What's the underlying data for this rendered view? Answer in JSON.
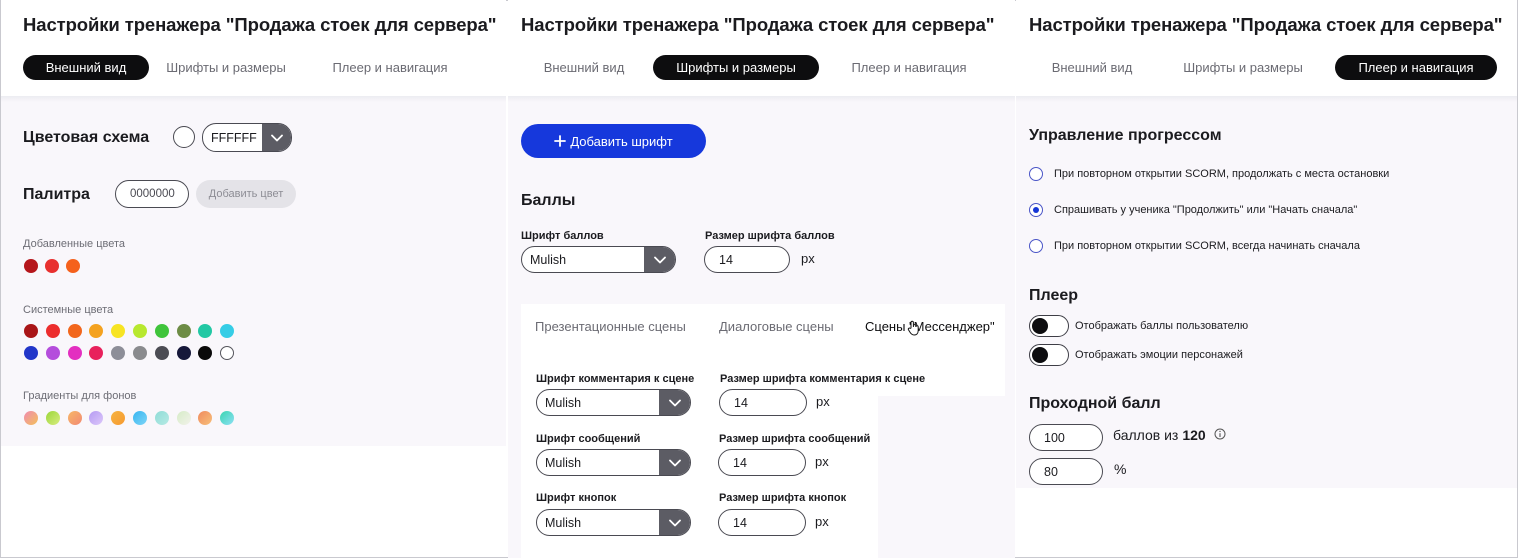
{
  "app_title": "Настройки тренажера \"Продажа стоек для сервера\"",
  "tabs": [
    "Внешний вид",
    "Шрифты и размеры",
    "Плеер и навигация"
  ],
  "appearance": {
    "color_scheme_label": "Цветовая схема",
    "color_scheme_value": "FFFFFF",
    "palette_label": "Палитра",
    "palette_input_placeholder": "0000000",
    "add_color_button": "Добавить цвет",
    "added_colors_label": "Добавленные цвета",
    "added_colors": [
      "#b5161b",
      "#e8302f",
      "#f5611c"
    ],
    "system_colors_label": "Системные цвета",
    "system_colors_row1": [
      "#a91517",
      "#ec2d2d",
      "#f2661c",
      "#f4a21f",
      "#f7e423",
      "#b7e82f",
      "#3fc43b",
      "#6d8c45",
      "#22c8a4",
      "#36cde6"
    ],
    "system_colors_row2": [
      "#2236c9",
      "#b44ddc",
      "#e32fc0",
      "#e8215c",
      "#8d8e98",
      "#8a8b8e",
      "#4c4c54",
      "#16183a",
      "#0a0a0a",
      "#ffffff"
    ],
    "gradients_label": "Градиенты для фонов",
    "gradients": [
      [
        "#f08ab0",
        "#f3c15b"
      ],
      [
        "#9bd63a",
        "#d8ed7f"
      ],
      [
        "#f7b768",
        "#f28972"
      ],
      [
        "#b59bf2",
        "#dcc7fa"
      ],
      [
        "#f5b342",
        "#f79a30"
      ],
      [
        "#37b5f0",
        "#7dd5f7"
      ],
      [
        "#8fdcd7",
        "#b6eae4"
      ],
      [
        "#d6ecc8",
        "#f2f2ea"
      ],
      [
        "#f08a5e",
        "#f7c07a"
      ],
      [
        "#38d5b0",
        "#8fe0f5"
      ]
    ]
  },
  "fonts": {
    "add_font_button": "Добавить шрифт",
    "scores_heading": "Баллы",
    "score_font_label": "Шрифт баллов",
    "score_font_value": "Mulish",
    "score_size_label": "Размер шрифта баллов",
    "score_size_value": "14",
    "unit": "px",
    "subtabs": [
      "Презентационные сцены",
      "Диалоговые сцены",
      "Сцены \"Мессенджер\""
    ],
    "comment_font_label": "Шрифт комментария к сцене",
    "comment_font_value": "Mulish",
    "comment_size_label": "Размер шрифта комментария к сцене",
    "comment_size_value": "14",
    "message_font_label": "Шрифт сообщений",
    "message_font_value": "Mulish",
    "message_size_label": "Размер шрифта сообщений",
    "message_size_value": "14",
    "button_font_label": "Шрифт кнопок",
    "button_font_value": "Mulish",
    "button_size_label": "Размер шрифта кнопок",
    "button_size_value": "14"
  },
  "player": {
    "progress_heading": "Управление прогрессом",
    "progress_options": [
      "При повторном открытии SCORM, продолжать с места остановки",
      "Спрашивать у ученика \"Продолжить\" или \"Начать сначала\"",
      "При повторном открытии SCORM, всегда начинать сначала"
    ],
    "progress_selected_index": 1,
    "player_heading": "Плеер",
    "toggle_show_scores": "Отображать баллы пользователю",
    "toggle_show_emotions": "Отображать эмоции персонажей",
    "passing_heading": "Проходной балл",
    "passing_score_value": "100",
    "passing_score_suffix": "баллов из",
    "passing_score_total": "120",
    "passing_percent_value": "80",
    "percent_sign": "%"
  }
}
